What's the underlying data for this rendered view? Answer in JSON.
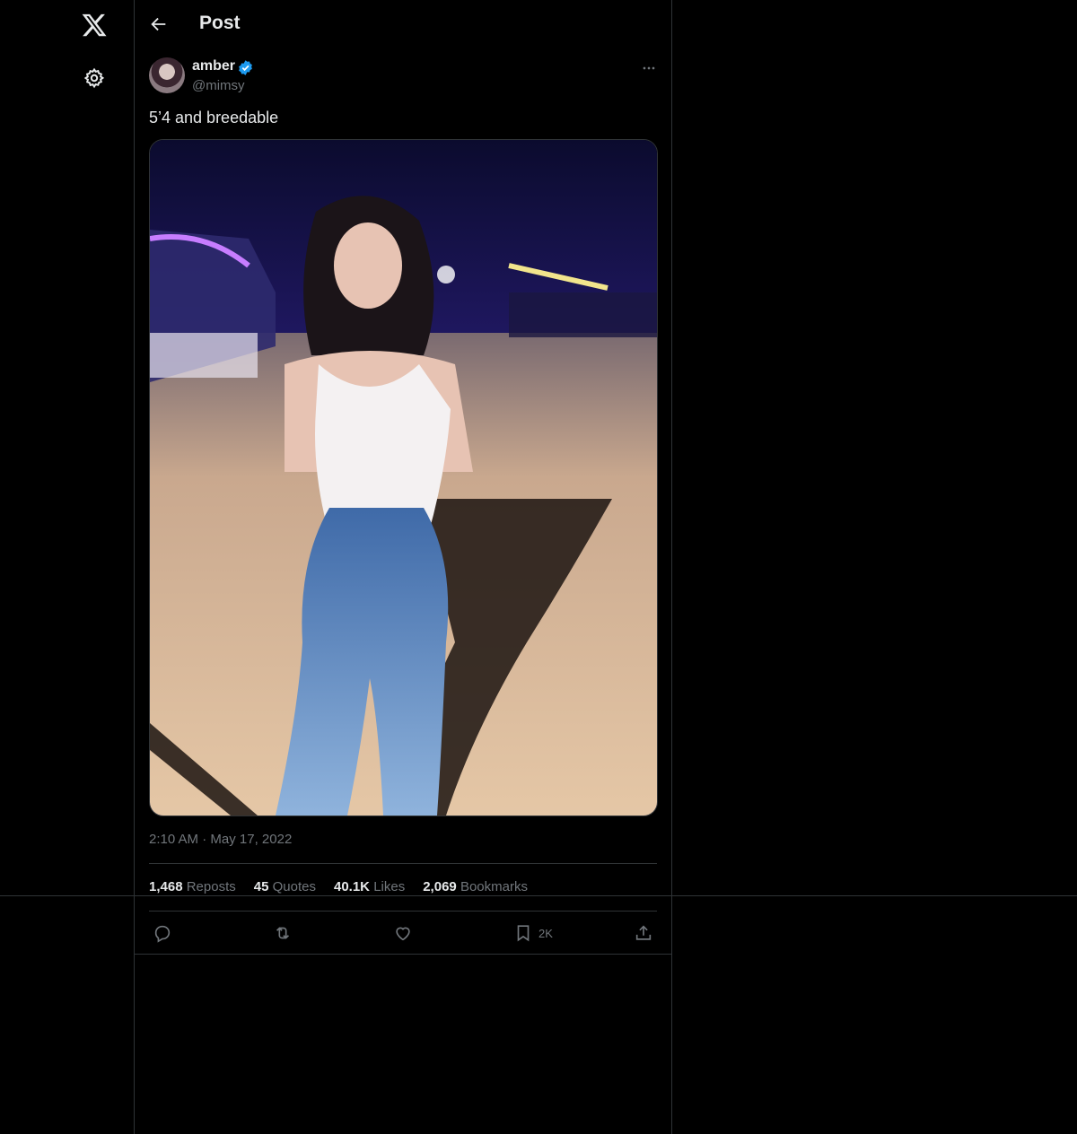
{
  "header": {
    "title": "Post"
  },
  "author": {
    "name": "amber",
    "handle": "@mimsy"
  },
  "post": {
    "text": "5’4 and breedable",
    "time": "2:10 AM",
    "separator": "·",
    "date": "May 17, 2022"
  },
  "stats": [
    {
      "value": "1,468",
      "label": "Reposts"
    },
    {
      "value": "45",
      "label": "Quotes"
    },
    {
      "value": "40.1K",
      "label": "Likes"
    },
    {
      "value": "2,069",
      "label": "Bookmarks"
    }
  ],
  "actions": {
    "bookmark_count": "2K"
  },
  "icons": [
    "x-logo-icon",
    "gear-icon",
    "back-arrow-icon",
    "verified-badge-icon",
    "more-icon",
    "reply-icon",
    "repost-icon",
    "like-icon",
    "bookmark-icon",
    "share-icon"
  ],
  "colors": {
    "background": "#000000",
    "text": "#e7e9ea",
    "muted": "#71767b",
    "border": "#2f3336",
    "verified": "#1d9bf0"
  }
}
